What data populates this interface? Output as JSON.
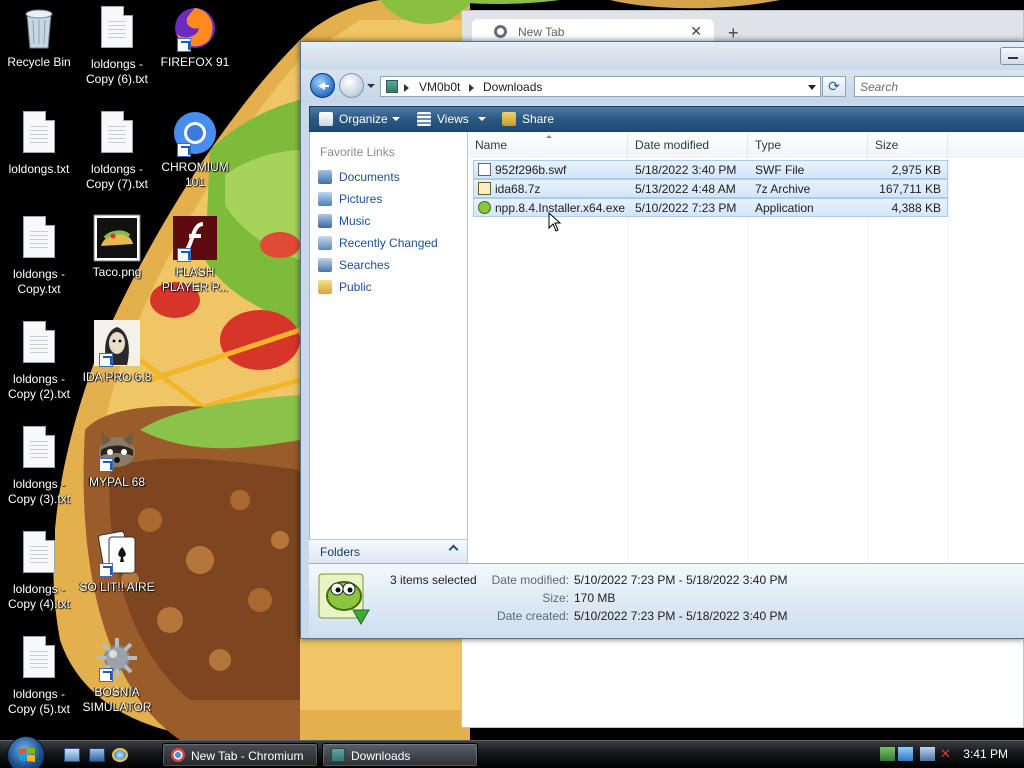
{
  "desktop": {
    "icons": [
      {
        "label": "Recycle Bin",
        "icon": "recycle-bin-icon"
      },
      {
        "label": "loldongs - Copy (6).txt",
        "icon": "text-file-icon"
      },
      {
        "label": "FIREFOX 91",
        "icon": "firefox-icon"
      },
      {
        "label": "loldongs.txt",
        "icon": "text-file-icon"
      },
      {
        "label": "loldongs - Copy (7).txt",
        "icon": "text-file-icon"
      },
      {
        "label": "CHROMIUM 101",
        "icon": "chromium-icon"
      },
      {
        "label": "loldongs - Copy.txt",
        "icon": "text-file-icon"
      },
      {
        "label": "Taco.png",
        "icon": "image-file-icon"
      },
      {
        "label": "FLASH PLAYER P...",
        "icon": "flash-player-icon"
      },
      {
        "label": "loldongs - Copy (2).txt",
        "icon": "text-file-icon"
      },
      {
        "label": "IDA PRO 6.8",
        "icon": "ida-pro-icon"
      },
      {
        "label": "loldongs - Copy (3).txt",
        "icon": "text-file-icon"
      },
      {
        "label": "MYPAL 68",
        "icon": "mypal-icon"
      },
      {
        "label": "loldongs - Copy (4).txt",
        "icon": "text-file-icon"
      },
      {
        "label": "SO LIT!! AIRE",
        "icon": "solitaire-icon"
      },
      {
        "label": "loldongs - Copy (5).txt",
        "icon": "text-file-icon"
      },
      {
        "label": "BOSNIA SIMULATOR",
        "icon": "bosnia-simulator-icon"
      }
    ]
  },
  "chromium": {
    "tab_title": "New Tab",
    "close_glyph": "✕",
    "new_tab_glyph": "+"
  },
  "explorer": {
    "breadcrumb": [
      "VM0b0t",
      "Downloads"
    ],
    "search_placeholder": "Search",
    "refresh_glyph": "⟳",
    "toolbar": {
      "organize": "Organize",
      "views": "Views",
      "share": "Share"
    },
    "favorite_links_title": "Favorite Links",
    "favorite_links": [
      {
        "label": "Documents",
        "icon": "documents-icon"
      },
      {
        "label": "Pictures",
        "icon": "pictures-icon"
      },
      {
        "label": "Music",
        "icon": "music-icon"
      },
      {
        "label": "Recently Changed",
        "icon": "recently-changed-icon"
      },
      {
        "label": "Searches",
        "icon": "searches-icon"
      },
      {
        "label": "Public",
        "icon": "public-folder-icon"
      }
    ],
    "folders_label": "Folders",
    "columns": [
      "Name",
      "Date modified",
      "Type",
      "Size"
    ],
    "files": [
      {
        "name": "952f296b.swf",
        "date": "5/18/2022 3:40 PM",
        "type": "SWF File",
        "size": "2,975 KB",
        "icon": "swf-file-icon"
      },
      {
        "name": "ida68.7z",
        "date": "5/13/2022 4:48 AM",
        "type": "7z Archive",
        "size": "167,711 KB",
        "icon": "archive-file-icon"
      },
      {
        "name": "npp.8.4.Installer.x64.exe",
        "date": "5/10/2022 7:23 PM",
        "type": "Application",
        "size": "4,388 KB",
        "icon": "notepad-plus-plus-icon"
      }
    ],
    "details": {
      "count": "3 items selected",
      "date_modified_label": "Date modified:",
      "date_modified_value": "5/10/2022 7:23 PM - 5/18/2022 3:40 PM",
      "size_label": "Size:",
      "size_value": "170 MB",
      "date_created_label": "Date created:",
      "date_created_value": "5/10/2022 7:23 PM - 5/18/2022 3:40 PM"
    }
  },
  "taskbar": {
    "buttons": [
      {
        "label": "New Tab - Chromium",
        "icon": "chromium-icon"
      },
      {
        "label": "Downloads",
        "icon": "folder-icon"
      }
    ],
    "clock": "3:41 PM"
  }
}
